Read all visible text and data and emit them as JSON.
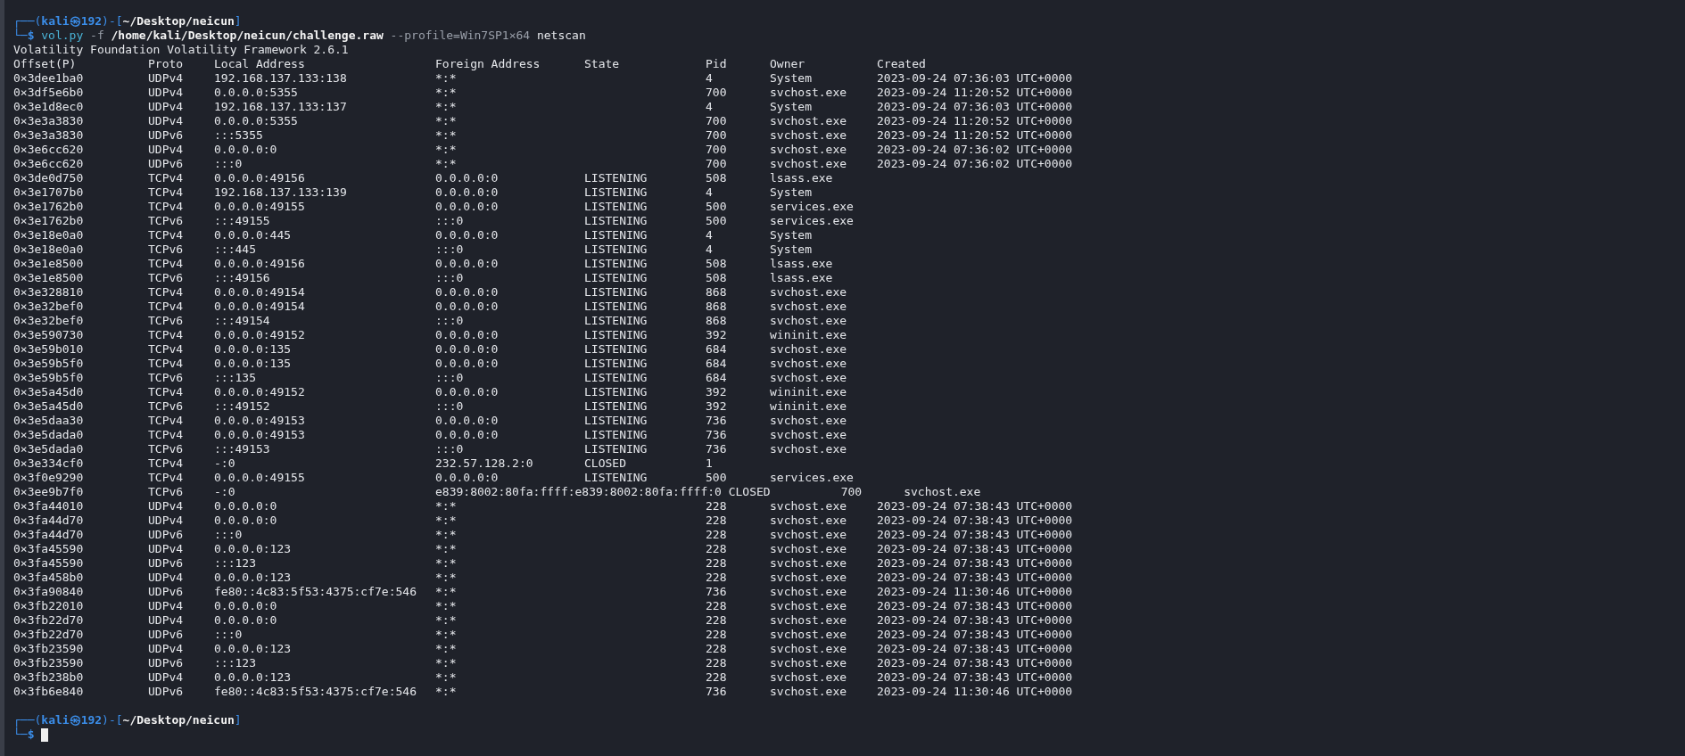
{
  "prompt": {
    "open": "┌──(",
    "user": "kali",
    "at": "㉿",
    "host": "192",
    "mid": ")-[",
    "path": "~/Desktop/neicun",
    "close": "]",
    "corner": "└─",
    "symbol": "$"
  },
  "command": {
    "program": "vol.py",
    "flag": "-f",
    "file": "/home/kali/Desktop/neicun/challenge.raw",
    "profile": "--profile=Win7SP1×64",
    "plugin": "netscan"
  },
  "banner": "Volatility Foundation Volatility Framework 2.6.1",
  "columns": [
    "Offset(P)",
    "Proto",
    "Local Address",
    "Foreign Address",
    "State",
    "Pid",
    "Owner",
    "Created"
  ],
  "rows": [
    {
      "kind": "normal",
      "offset": "0×3dee1ba0",
      "proto": "UDPv4",
      "local": "192.168.137.133:138",
      "foreign": "*:*",
      "pid": "4",
      "owner": "System",
      "created": "2023-09-24 07:36:03 UTC+0000"
    },
    {
      "kind": "normal",
      "offset": "0×3df5e6b0",
      "proto": "UDPv4",
      "local": "0.0.0.0:5355",
      "foreign": "*:*",
      "pid": "700",
      "owner": "svchost.exe",
      "created": "2023-09-24 11:20:52 UTC+0000"
    },
    {
      "kind": "normal",
      "offset": "0×3e1d8ec0",
      "proto": "UDPv4",
      "local": "192.168.137.133:137",
      "foreign": "*:*",
      "pid": "4",
      "owner": "System",
      "created": "2023-09-24 07:36:03 UTC+0000"
    },
    {
      "kind": "normal",
      "offset": "0×3e3a3830",
      "proto": "UDPv4",
      "local": "0.0.0.0:5355",
      "foreign": "*:*",
      "pid": "700",
      "owner": "svchost.exe",
      "created": "2023-09-24 11:20:52 UTC+0000"
    },
    {
      "kind": "normal",
      "offset": "0×3e3a3830",
      "proto": "UDPv6",
      "local": ":::5355",
      "foreign": "*:*",
      "pid": "700",
      "owner": "svchost.exe",
      "created": "2023-09-24 11:20:52 UTC+0000"
    },
    {
      "kind": "normal",
      "offset": "0×3e6cc620",
      "proto": "UDPv4",
      "local": "0.0.0.0:0",
      "foreign": "*:*",
      "pid": "700",
      "owner": "svchost.exe",
      "created": "2023-09-24 07:36:02 UTC+0000"
    },
    {
      "kind": "normal",
      "offset": "0×3e6cc620",
      "proto": "UDPv6",
      "local": ":::0",
      "foreign": "*:*",
      "pid": "700",
      "owner": "svchost.exe",
      "created": "2023-09-24 07:36:02 UTC+0000"
    },
    {
      "kind": "normal",
      "offset": "0×3de0d750",
      "proto": "TCPv4",
      "local": "0.0.0.0:49156",
      "foreign": "0.0.0.0:0",
      "state": "LISTENING",
      "pid": "508",
      "owner": "lsass.exe"
    },
    {
      "kind": "normal",
      "offset": "0×3e1707b0",
      "proto": "TCPv4",
      "local": "192.168.137.133:139",
      "foreign": "0.0.0.0:0",
      "state": "LISTENING",
      "pid": "4",
      "owner": "System"
    },
    {
      "kind": "normal",
      "offset": "0×3e1762b0",
      "proto": "TCPv4",
      "local": "0.0.0.0:49155",
      "foreign": "0.0.0.0:0",
      "state": "LISTENING",
      "pid": "500",
      "owner": "services.exe"
    },
    {
      "kind": "normal",
      "offset": "0×3e1762b0",
      "proto": "TCPv6",
      "local": ":::49155",
      "foreign": ":::0",
      "state": "LISTENING",
      "pid": "500",
      "owner": "services.exe"
    },
    {
      "kind": "normal",
      "offset": "0×3e18e0a0",
      "proto": "TCPv4",
      "local": "0.0.0.0:445",
      "foreign": "0.0.0.0:0",
      "state": "LISTENING",
      "pid": "4",
      "owner": "System"
    },
    {
      "kind": "normal",
      "offset": "0×3e18e0a0",
      "proto": "TCPv6",
      "local": ":::445",
      "foreign": ":::0",
      "state": "LISTENING",
      "pid": "4",
      "owner": "System"
    },
    {
      "kind": "normal",
      "offset": "0×3e1e8500",
      "proto": "TCPv4",
      "local": "0.0.0.0:49156",
      "foreign": "0.0.0.0:0",
      "state": "LISTENING",
      "pid": "508",
      "owner": "lsass.exe"
    },
    {
      "kind": "normal",
      "offset": "0×3e1e8500",
      "proto": "TCPv6",
      "local": ":::49156",
      "foreign": ":::0",
      "state": "LISTENING",
      "pid": "508",
      "owner": "lsass.exe"
    },
    {
      "kind": "normal",
      "offset": "0×3e328810",
      "proto": "TCPv4",
      "local": "0.0.0.0:49154",
      "foreign": "0.0.0.0:0",
      "state": "LISTENING",
      "pid": "868",
      "owner": "svchost.exe"
    },
    {
      "kind": "normal",
      "offset": "0×3e32bef0",
      "proto": "TCPv4",
      "local": "0.0.0.0:49154",
      "foreign": "0.0.0.0:0",
      "state": "LISTENING",
      "pid": "868",
      "owner": "svchost.exe"
    },
    {
      "kind": "normal",
      "offset": "0×3e32bef0",
      "proto": "TCPv6",
      "local": ":::49154",
      "foreign": ":::0",
      "state": "LISTENING",
      "pid": "868",
      "owner": "svchost.exe"
    },
    {
      "kind": "normal",
      "offset": "0×3e590730",
      "proto": "TCPv4",
      "local": "0.0.0.0:49152",
      "foreign": "0.0.0.0:0",
      "state": "LISTENING",
      "pid": "392",
      "owner": "wininit.exe"
    },
    {
      "kind": "normal",
      "offset": "0×3e59b010",
      "proto": "TCPv4",
      "local": "0.0.0.0:135",
      "foreign": "0.0.0.0:0",
      "state": "LISTENING",
      "pid": "684",
      "owner": "svchost.exe"
    },
    {
      "kind": "normal",
      "offset": "0×3e59b5f0",
      "proto": "TCPv4",
      "local": "0.0.0.0:135",
      "foreign": "0.0.0.0:0",
      "state": "LISTENING",
      "pid": "684",
      "owner": "svchost.exe"
    },
    {
      "kind": "normal",
      "offset": "0×3e59b5f0",
      "proto": "TCPv6",
      "local": ":::135",
      "foreign": ":::0",
      "state": "LISTENING",
      "pid": "684",
      "owner": "svchost.exe"
    },
    {
      "kind": "normal",
      "offset": "0×3e5a45d0",
      "proto": "TCPv4",
      "local": "0.0.0.0:49152",
      "foreign": "0.0.0.0:0",
      "state": "LISTENING",
      "pid": "392",
      "owner": "wininit.exe"
    },
    {
      "kind": "normal",
      "offset": "0×3e5a45d0",
      "proto": "TCPv6",
      "local": ":::49152",
      "foreign": ":::0",
      "state": "LISTENING",
      "pid": "392",
      "owner": "wininit.exe"
    },
    {
      "kind": "normal",
      "offset": "0×3e5daa30",
      "proto": "TCPv4",
      "local": "0.0.0.0:49153",
      "foreign": "0.0.0.0:0",
      "state": "LISTENING",
      "pid": "736",
      "owner": "svchost.exe"
    },
    {
      "kind": "normal",
      "offset": "0×3e5dada0",
      "proto": "TCPv4",
      "local": "0.0.0.0:49153",
      "foreign": "0.0.0.0:0",
      "state": "LISTENING",
      "pid": "736",
      "owner": "svchost.exe"
    },
    {
      "kind": "normal",
      "offset": "0×3e5dada0",
      "proto": "TCPv6",
      "local": ":::49153",
      "foreign": ":::0",
      "state": "LISTENING",
      "pid": "736",
      "owner": "svchost.exe"
    },
    {
      "kind": "normal",
      "offset": "0×3e334cf0",
      "proto": "TCPv4",
      "local": "-:0",
      "foreign": "232.57.128.2:0",
      "state": "CLOSED",
      "pid": "1"
    },
    {
      "kind": "normal",
      "offset": "0×3f0e9290",
      "proto": "TCPv4",
      "local": "0.0.0.0:49155",
      "foreign": "0.0.0.0:0",
      "state": "LISTENING",
      "pid": "500",
      "owner": "services.exe"
    },
    {
      "kind": "wide",
      "offset": "0×3ee9b7f0",
      "proto": "TCPv6",
      "local": "-:0",
      "foreign": "e839:8002:80fa:ffff:e839:8002:80fa:ffff:0",
      "shifted_state": "CLOSED",
      "shifted_pid": "700",
      "shifted_owner": "svchost.exe"
    },
    {
      "kind": "normal",
      "offset": "0×3fa44010",
      "proto": "UDPv4",
      "local": "0.0.0.0:0",
      "foreign": "*:*",
      "pid": "228",
      "owner": "svchost.exe",
      "created": "2023-09-24 07:38:43 UTC+0000"
    },
    {
      "kind": "normal",
      "offset": "0×3fa44d70",
      "proto": "UDPv4",
      "local": "0.0.0.0:0",
      "foreign": "*:*",
      "pid": "228",
      "owner": "svchost.exe",
      "created": "2023-09-24 07:38:43 UTC+0000"
    },
    {
      "kind": "normal",
      "offset": "0×3fa44d70",
      "proto": "UDPv6",
      "local": ":::0",
      "foreign": "*:*",
      "pid": "228",
      "owner": "svchost.exe",
      "created": "2023-09-24 07:38:43 UTC+0000"
    },
    {
      "kind": "normal",
      "offset": "0×3fa45590",
      "proto": "UDPv4",
      "local": "0.0.0.0:123",
      "foreign": "*:*",
      "pid": "228",
      "owner": "svchost.exe",
      "created": "2023-09-24 07:38:43 UTC+0000"
    },
    {
      "kind": "normal",
      "offset": "0×3fa45590",
      "proto": "UDPv6",
      "local": ":::123",
      "foreign": "*:*",
      "pid": "228",
      "owner": "svchost.exe",
      "created": "2023-09-24 07:38:43 UTC+0000"
    },
    {
      "kind": "normal",
      "offset": "0×3fa458b0",
      "proto": "UDPv4",
      "local": "0.0.0.0:123",
      "foreign": "*:*",
      "pid": "228",
      "owner": "svchost.exe",
      "created": "2023-09-24 07:38:43 UTC+0000"
    },
    {
      "kind": "normal",
      "offset": "0×3fa90840",
      "proto": "UDPv6",
      "local": "fe80::4c83:5f53:4375:cf7e:546",
      "foreign": "*:*",
      "pid": "736",
      "owner": "svchost.exe",
      "created": "2023-09-24 11:30:46 UTC+0000"
    },
    {
      "kind": "normal",
      "offset": "0×3fb22010",
      "proto": "UDPv4",
      "local": "0.0.0.0:0",
      "foreign": "*:*",
      "pid": "228",
      "owner": "svchost.exe",
      "created": "2023-09-24 07:38:43 UTC+0000"
    },
    {
      "kind": "normal",
      "offset": "0×3fb22d70",
      "proto": "UDPv4",
      "local": "0.0.0.0:0",
      "foreign": "*:*",
      "pid": "228",
      "owner": "svchost.exe",
      "created": "2023-09-24 07:38:43 UTC+0000"
    },
    {
      "kind": "normal",
      "offset": "0×3fb22d70",
      "proto": "UDPv6",
      "local": ":::0",
      "foreign": "*:*",
      "pid": "228",
      "owner": "svchost.exe",
      "created": "2023-09-24 07:38:43 UTC+0000"
    },
    {
      "kind": "normal",
      "offset": "0×3fb23590",
      "proto": "UDPv4",
      "local": "0.0.0.0:123",
      "foreign": "*:*",
      "pid": "228",
      "owner": "svchost.exe",
      "created": "2023-09-24 07:38:43 UTC+0000"
    },
    {
      "kind": "normal",
      "offset": "0×3fb23590",
      "proto": "UDPv6",
      "local": ":::123",
      "foreign": "*:*",
      "pid": "228",
      "owner": "svchost.exe",
      "created": "2023-09-24 07:38:43 UTC+0000"
    },
    {
      "kind": "normal",
      "offset": "0×3fb238b0",
      "proto": "UDPv4",
      "local": "0.0.0.0:123",
      "foreign": "*:*",
      "pid": "228",
      "owner": "svchost.exe",
      "created": "2023-09-24 07:38:43 UTC+0000"
    },
    {
      "kind": "normal",
      "offset": "0×3fb6e840",
      "proto": "UDPv6",
      "local": "fe80::4c83:5f53:4375:cf7e:546",
      "foreign": "*:*",
      "pid": "736",
      "owner": "svchost.exe",
      "created": "2023-09-24 11:30:46 UTC+0000"
    }
  ],
  "final_prompt": {
    "open": "┌──(",
    "user": "kali",
    "at": "㉿",
    "host": "192",
    "mid": ")-[",
    "path": "~/Desktop/neicun",
    "close": "]",
    "corner": "└─",
    "symbol": "$"
  }
}
